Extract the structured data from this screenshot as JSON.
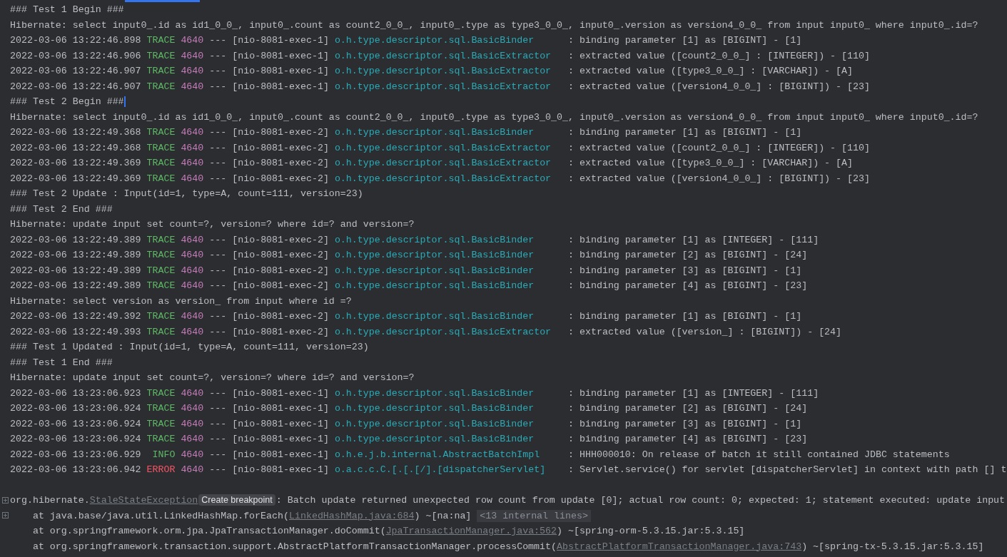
{
  "console": {
    "lines": [
      {
        "kind": "plain",
        "text": "### Test 1 Begin ###"
      },
      {
        "kind": "plain",
        "text": "Hibernate: select input0_.id as id1_0_0_, input0_.count as count2_0_0_, input0_.type as type3_0_0_, input0_.version as version4_0_0_ from input input0_ where input0_.id=?"
      },
      {
        "kind": "log",
        "time": "2022-03-06 13:22:46.898",
        "level": "TRACE",
        "pid": "4640",
        "sep": "---",
        "thread": "[nio-8081-exec-1]",
        "logger": "o.h.type.descriptor.sql.BasicBinder",
        "message": ": binding parameter [1] as [BIGINT] - [1]"
      },
      {
        "kind": "log",
        "time": "2022-03-06 13:22:46.906",
        "level": "TRACE",
        "pid": "4640",
        "sep": "---",
        "thread": "[nio-8081-exec-1]",
        "logger": "o.h.type.descriptor.sql.BasicExtractor",
        "message": ": extracted value ([count2_0_0_] : [INTEGER]) - [110]"
      },
      {
        "kind": "log",
        "time": "2022-03-06 13:22:46.907",
        "level": "TRACE",
        "pid": "4640",
        "sep": "---",
        "thread": "[nio-8081-exec-1]",
        "logger": "o.h.type.descriptor.sql.BasicExtractor",
        "message": ": extracted value ([type3_0_0_] : [VARCHAR]) - [A]"
      },
      {
        "kind": "log",
        "time": "2022-03-06 13:22:46.907",
        "level": "TRACE",
        "pid": "4640",
        "sep": "---",
        "thread": "[nio-8081-exec-1]",
        "logger": "o.h.type.descriptor.sql.BasicExtractor",
        "message": ": extracted value ([version4_0_0_] : [BIGINT]) - [23]"
      },
      {
        "kind": "plain",
        "text": "### Test 2 Begin ###",
        "cursor": true
      },
      {
        "kind": "plain",
        "text": "Hibernate: select input0_.id as id1_0_0_, input0_.count as count2_0_0_, input0_.type as type3_0_0_, input0_.version as version4_0_0_ from input input0_ where input0_.id=?"
      },
      {
        "kind": "log",
        "time": "2022-03-06 13:22:49.368",
        "level": "TRACE",
        "pid": "4640",
        "sep": "---",
        "thread": "[nio-8081-exec-2]",
        "logger": "o.h.type.descriptor.sql.BasicBinder",
        "message": ": binding parameter [1] as [BIGINT] - [1]"
      },
      {
        "kind": "log",
        "time": "2022-03-06 13:22:49.368",
        "level": "TRACE",
        "pid": "4640",
        "sep": "---",
        "thread": "[nio-8081-exec-2]",
        "logger": "o.h.type.descriptor.sql.BasicExtractor",
        "message": ": extracted value ([count2_0_0_] : [INTEGER]) - [110]"
      },
      {
        "kind": "log",
        "time": "2022-03-06 13:22:49.369",
        "level": "TRACE",
        "pid": "4640",
        "sep": "---",
        "thread": "[nio-8081-exec-2]",
        "logger": "o.h.type.descriptor.sql.BasicExtractor",
        "message": ": extracted value ([type3_0_0_] : [VARCHAR]) - [A]"
      },
      {
        "kind": "log",
        "time": "2022-03-06 13:22:49.369",
        "level": "TRACE",
        "pid": "4640",
        "sep": "---",
        "thread": "[nio-8081-exec-2]",
        "logger": "o.h.type.descriptor.sql.BasicExtractor",
        "message": ": extracted value ([version4_0_0_] : [BIGINT]) - [23]"
      },
      {
        "kind": "plain",
        "text": "### Test 2 Update : Input(id=1, type=A, count=111, version=23)"
      },
      {
        "kind": "plain",
        "text": "### Test 2 End ###"
      },
      {
        "kind": "plain",
        "text": "Hibernate: update input set count=?, version=? where id=? and version=?"
      },
      {
        "kind": "log",
        "time": "2022-03-06 13:22:49.389",
        "level": "TRACE",
        "pid": "4640",
        "sep": "---",
        "thread": "[nio-8081-exec-2]",
        "logger": "o.h.type.descriptor.sql.BasicBinder",
        "message": ": binding parameter [1] as [INTEGER] - [111]"
      },
      {
        "kind": "log",
        "time": "2022-03-06 13:22:49.389",
        "level": "TRACE",
        "pid": "4640",
        "sep": "---",
        "thread": "[nio-8081-exec-2]",
        "logger": "o.h.type.descriptor.sql.BasicBinder",
        "message": ": binding parameter [2] as [BIGINT] - [24]"
      },
      {
        "kind": "log",
        "time": "2022-03-06 13:22:49.389",
        "level": "TRACE",
        "pid": "4640",
        "sep": "---",
        "thread": "[nio-8081-exec-2]",
        "logger": "o.h.type.descriptor.sql.BasicBinder",
        "message": ": binding parameter [3] as [BIGINT] - [1]"
      },
      {
        "kind": "log",
        "time": "2022-03-06 13:22:49.389",
        "level": "TRACE",
        "pid": "4640",
        "sep": "---",
        "thread": "[nio-8081-exec-2]",
        "logger": "o.h.type.descriptor.sql.BasicBinder",
        "message": ": binding parameter [4] as [BIGINT] - [23]"
      },
      {
        "kind": "plain",
        "text": "Hibernate: select version as version_ from input where id =?"
      },
      {
        "kind": "log",
        "time": "2022-03-06 13:22:49.392",
        "level": "TRACE",
        "pid": "4640",
        "sep": "---",
        "thread": "[nio-8081-exec-2]",
        "logger": "o.h.type.descriptor.sql.BasicBinder",
        "message": ": binding parameter [1] as [BIGINT] - [1]"
      },
      {
        "kind": "log",
        "time": "2022-03-06 13:22:49.393",
        "level": "TRACE",
        "pid": "4640",
        "sep": "---",
        "thread": "[nio-8081-exec-2]",
        "logger": "o.h.type.descriptor.sql.BasicExtractor",
        "message": ": extracted value ([version_] : [BIGINT]) - [24]"
      },
      {
        "kind": "plain",
        "text": "### Test 1 Updated : Input(id=1, type=A, count=111, version=23)"
      },
      {
        "kind": "plain",
        "text": "### Test 1 End ###"
      },
      {
        "kind": "plain",
        "text": "Hibernate: update input set count=?, version=? where id=? and version=?"
      },
      {
        "kind": "log",
        "time": "2022-03-06 13:23:06.923",
        "level": "TRACE",
        "pid": "4640",
        "sep": "---",
        "thread": "[nio-8081-exec-1]",
        "logger": "o.h.type.descriptor.sql.BasicBinder",
        "message": ": binding parameter [1] as [INTEGER] - [111]"
      },
      {
        "kind": "log",
        "time": "2022-03-06 13:23:06.924",
        "level": "TRACE",
        "pid": "4640",
        "sep": "---",
        "thread": "[nio-8081-exec-1]",
        "logger": "o.h.type.descriptor.sql.BasicBinder",
        "message": ": binding parameter [2] as [BIGINT] - [24]"
      },
      {
        "kind": "log",
        "time": "2022-03-06 13:23:06.924",
        "level": "TRACE",
        "pid": "4640",
        "sep": "---",
        "thread": "[nio-8081-exec-1]",
        "logger": "o.h.type.descriptor.sql.BasicBinder",
        "message": ": binding parameter [3] as [BIGINT] - [1]"
      },
      {
        "kind": "log",
        "time": "2022-03-06 13:23:06.924",
        "level": "TRACE",
        "pid": "4640",
        "sep": "---",
        "thread": "[nio-8081-exec-1]",
        "logger": "o.h.type.descriptor.sql.BasicBinder",
        "message": ": binding parameter [4] as [BIGINT] - [23]"
      },
      {
        "kind": "log",
        "time": "2022-03-06 13:23:06.929",
        "level": "INFO",
        "pid": "4640",
        "sep": "---",
        "thread": "[nio-8081-exec-1]",
        "logger": "o.h.e.j.b.internal.AbstractBatchImpl",
        "message": ": HHH000010: On release of batch it still contained JDBC statements"
      },
      {
        "kind": "log",
        "time": "2022-03-06 13:23:06.942",
        "level": "ERROR",
        "pid": "4640",
        "sep": "---",
        "thread": "[nio-8081-exec-1]",
        "logger": "o.a.c.c.C.[.[.[/].[dispatcherServlet]",
        "message": ": Servlet.service() for servlet [dispatcherServlet] in context with path [] t"
      },
      {
        "kind": "blank"
      },
      {
        "kind": "exception",
        "expandable": true,
        "prefix": "org.hibernate.",
        "link": "StaleStateException",
        "hint": "Create breakpoint",
        "message": ": Batch update returned unexpected row count from update [0]; actual row count: 0; expected: 1; statement executed: update input"
      },
      {
        "kind": "stack",
        "expandable": true,
        "prefix": "at java.base/java.util.LinkedHashMap.forEach(",
        "link": "LinkedHashMap.java:684",
        "suffix": ") ~[na:na]",
        "folded": "<13 internal lines>"
      },
      {
        "kind": "stack",
        "expandable": false,
        "prefix": "at org.springframework.orm.jpa.JpaTransactionManager.doCommit(",
        "link": "JpaTransactionManager.java:562",
        "suffix": ") ~[spring-orm-5.3.15.jar:5.3.15]"
      },
      {
        "kind": "stack",
        "expandable": false,
        "prefix": "at org.springframework.transaction.support.AbstractPlatformTransactionManager.processCommit(",
        "link": "AbstractPlatformTransactionManager.java:743",
        "suffix": ") ~[spring-tx-5.3.15.jar:5.3.15]"
      }
    ]
  }
}
